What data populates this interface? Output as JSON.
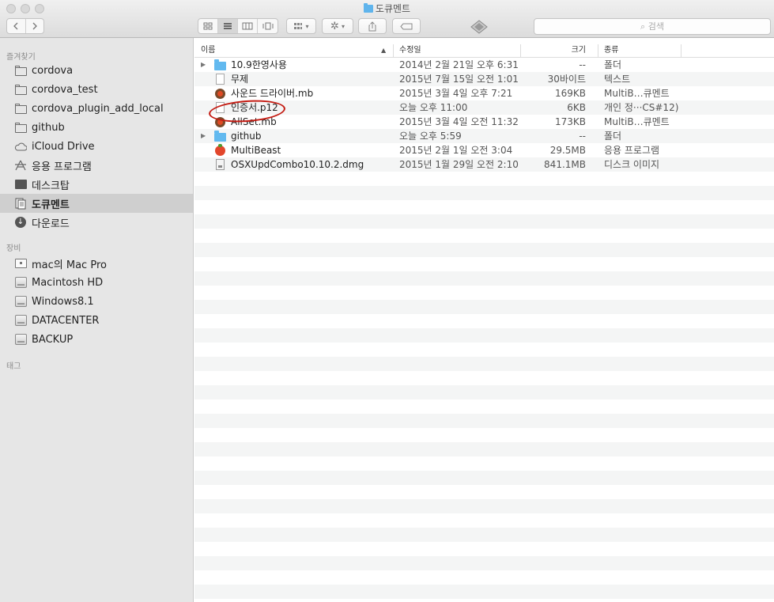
{
  "window": {
    "title": "도큐멘트"
  },
  "toolbar": {
    "back_icon": "chevron-left-icon",
    "forward_icon": "chevron-right-icon",
    "view_modes": [
      "icon-view-icon",
      "list-view-icon",
      "column-view-icon",
      "cover-flow-icon"
    ],
    "active_view": "list-view-icon",
    "search_placeholder": "검색"
  },
  "sidebar": {
    "favorites_header": "즐겨찾기",
    "devices_header": "장비",
    "tags_header": "태그",
    "favorites": [
      {
        "label": "cordova",
        "icon": "folder-icon"
      },
      {
        "label": "cordova_test",
        "icon": "folder-icon"
      },
      {
        "label": "cordova_plugin_add_local",
        "icon": "folder-icon"
      },
      {
        "label": "github",
        "icon": "folder-icon"
      },
      {
        "label": "iCloud Drive",
        "icon": "cloud-icon"
      },
      {
        "label": "응용 프로그램",
        "icon": "applications-icon"
      },
      {
        "label": "데스크탑",
        "icon": "desktop-icon"
      },
      {
        "label": "도큐멘트",
        "icon": "documents-icon",
        "selected": true
      },
      {
        "label": "다운로드",
        "icon": "download-icon"
      }
    ],
    "devices": [
      {
        "label": "mac의 Mac Pro",
        "icon": "computer-icon"
      },
      {
        "label": "Macintosh HD",
        "icon": "disk-icon"
      },
      {
        "label": "Windows8.1",
        "icon": "disk-icon"
      },
      {
        "label": "DATACENTER",
        "icon": "disk-icon"
      },
      {
        "label": "BACKUP",
        "icon": "disk-icon"
      }
    ]
  },
  "list": {
    "columns": {
      "name": "이름",
      "date": "수정일",
      "size": "크기",
      "kind": "종류"
    },
    "rows": [
      {
        "name": "10.9한영사용",
        "date": "2014년 2월 21일 오후 6:31",
        "size": "--",
        "kind": "폴더",
        "icon": "folder-icon",
        "expandable": true
      },
      {
        "name": "무제",
        "date": "2015년 7월 15일 오전 1:01",
        "size": "30바이트",
        "kind": "텍스트",
        "icon": "document-icon",
        "expandable": false
      },
      {
        "name": "사운드 드라이버.mb",
        "date": "2015년 3월 4일 오후 7:21",
        "size": "169KB",
        "kind": "MultiB…큐멘트",
        "icon": "multibeast-doc-icon",
        "expandable": false
      },
      {
        "name": "인증서.p12",
        "date": "오늘 오후 11:00",
        "size": "6KB",
        "kind": "개인 정···CS#12)",
        "icon": "document-icon",
        "expandable": false
      },
      {
        "name": "AllSet.mb",
        "date": "2015년 3월 4일 오전 11:32",
        "size": "173KB",
        "kind": "MultiB…큐멘트",
        "icon": "multibeast-doc-icon",
        "expandable": false
      },
      {
        "name": "github",
        "date": "오늘 오후 5:59",
        "size": "--",
        "kind": "폴더",
        "icon": "folder-icon",
        "expandable": true
      },
      {
        "name": "MultiBeast",
        "date": "2015년 2월 1일 오전 3:04",
        "size": "29.5MB",
        "kind": "응용 프로그램",
        "icon": "multibeast-app-icon",
        "expandable": false
      },
      {
        "name": "OSXUpdCombo10.10.2.dmg",
        "date": "2015년 1월 29일 오전 2:10",
        "size": "841.1MB",
        "kind": "디스크 이미지",
        "icon": "disk-image-icon",
        "expandable": false
      }
    ],
    "highlighted_item": "인증서.p12",
    "highlight_color": "#c41b12"
  }
}
